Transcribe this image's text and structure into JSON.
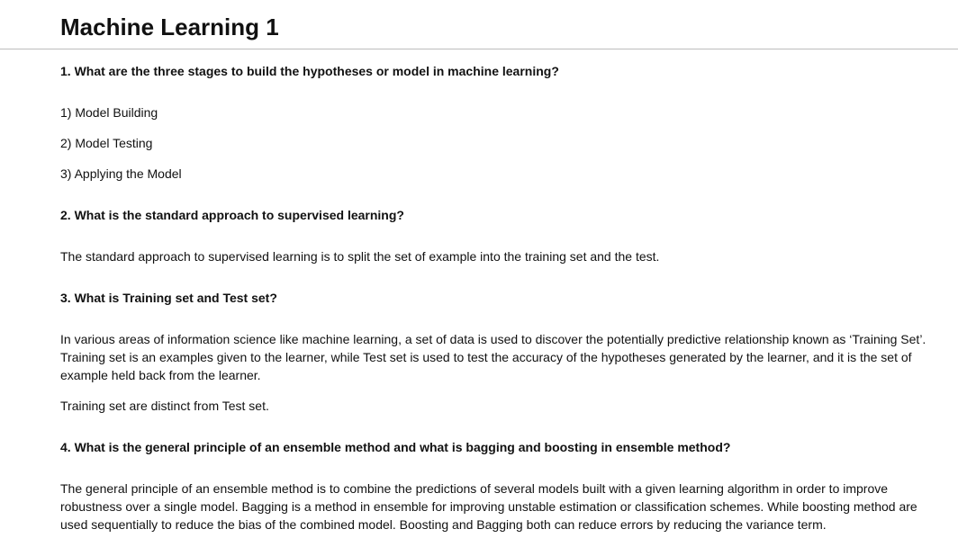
{
  "page_title": "Machine Learning 1",
  "sections": [
    {
      "question": "1. What are the three stages to build the hypotheses or model in machine learning?",
      "items": [
        "1) Model Building",
        "2) Model Testing",
        "3) Applying the Model"
      ]
    },
    {
      "question": "2. What is the standard approach to supervised learning?",
      "paragraphs": [
        "The standard approach to supervised learning is to split the set of example into the training set and the test."
      ]
    },
    {
      "question": "3. What is Training set and Test set?",
      "paragraphs": [
        "In various areas of information science like machine learning, a set of data is used to discover the potentially predictive relationship known as ‘Training Set’. Training set is an examples given to the learner, while Test set is used to test the accuracy of the hypotheses generated by the learner, and it is the set of example held back from the learner.",
        "Training set are distinct from Test set."
      ]
    },
    {
      "question": "4. What is the general principle of an ensemble method and what is bagging and boosting in ensemble method?",
      "paragraphs": [
        "The general principle of an ensemble method is to combine the predictions of several models built with a given learning algorithm in order to improve robustness over a single model. Bagging is a method in ensemble for improving unstable estimation or classification schemes. While boosting method are used sequentially to reduce the bias of the combined model. Boosting and Bagging both can reduce errors by reducing the variance term."
      ]
    }
  ]
}
